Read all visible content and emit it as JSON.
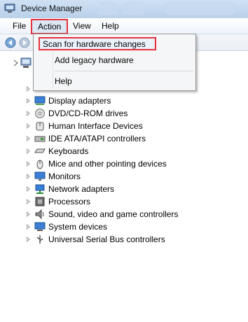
{
  "window": {
    "title": "Device Manager"
  },
  "menubar": {
    "file": "File",
    "action": "Action",
    "view": "View",
    "help": "Help"
  },
  "action_menu": {
    "items": [
      "Scan for hardware changes",
      "Add legacy hardware",
      "Help"
    ],
    "highlighted": "Scan for hardware changes"
  },
  "tree": {
    "categories": [
      {
        "label": "Display adapters",
        "icon": "display-adapter-icon"
      },
      {
        "label": "DVD/CD-ROM drives",
        "icon": "disc-drive-icon"
      },
      {
        "label": "Human Interface Devices",
        "icon": "hid-icon"
      },
      {
        "label": "IDE ATA/ATAPI controllers",
        "icon": "ide-controller-icon"
      },
      {
        "label": "Keyboards",
        "icon": "keyboard-icon"
      },
      {
        "label": "Mice and other pointing devices",
        "icon": "mouse-icon"
      },
      {
        "label": "Monitors",
        "icon": "monitor-icon"
      },
      {
        "label": "Network adapters",
        "icon": "network-adapter-icon"
      },
      {
        "label": "Processors",
        "icon": "processor-icon"
      },
      {
        "label": "Sound, video and game controllers",
        "icon": "speaker-icon"
      },
      {
        "label": "System devices",
        "icon": "system-devices-icon"
      },
      {
        "label": "Universal Serial Bus controllers",
        "icon": "usb-icon"
      }
    ]
  },
  "colors": {
    "highlight_border": "#e5313b",
    "titlebar": "#b9d1ea"
  }
}
